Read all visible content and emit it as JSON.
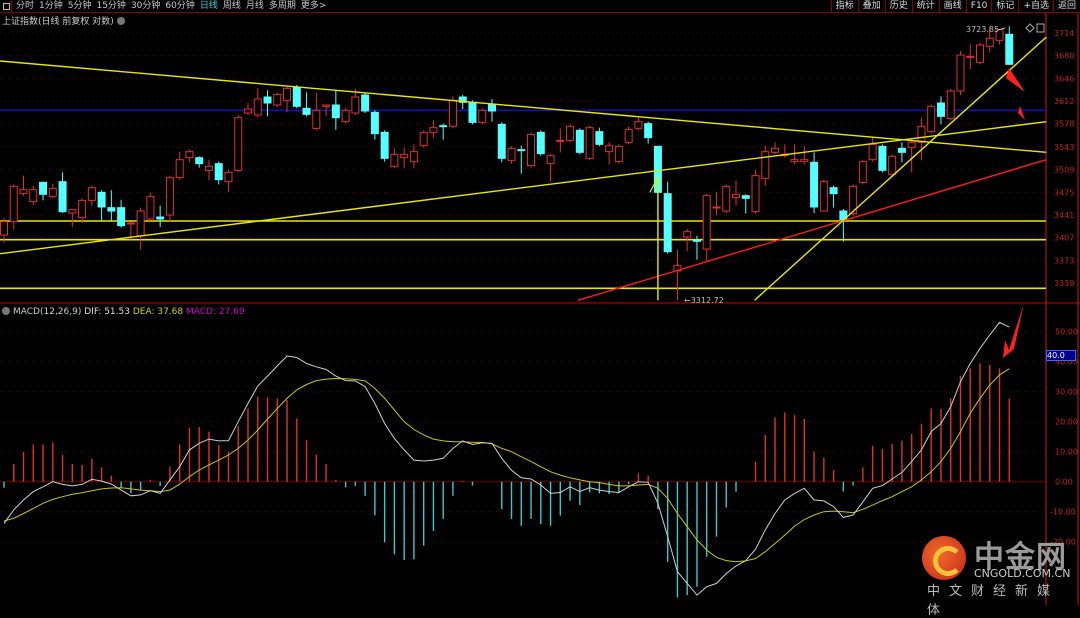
{
  "toolbar": {
    "left": [
      "分时",
      "1分钟",
      "5分钟",
      "15分钟",
      "30分钟",
      "60分钟",
      "日线",
      "周线",
      "月线",
      "多周期",
      "更多>"
    ],
    "active": "日线",
    "right": [
      "指标",
      "叠加",
      "历史",
      "统计",
      "画线",
      "F10",
      "标记",
      "+自选",
      "返回"
    ]
  },
  "subtitle": "上证指数(日线 前复权 对数)",
  "macd_header": {
    "name": "MACD(12,26,9)",
    "dif": "DIF: 51.53",
    "dea": "DEA: 37.68",
    "macd": "MACD: 27.69"
  },
  "macd_highlight": "40.0",
  "logo": {
    "cn": "中金网",
    "domain": "CNGOLD.COM.CN",
    "tagline": "中文财经新媒体"
  },
  "colors": {
    "up": "#e03030",
    "down": "#54ffff",
    "dif": "#d0d0d0",
    "dea": "#c8c800",
    "macd_label": "#d000d0",
    "axis": "#c02020",
    "grid": "#5a0000"
  },
  "chart_data": [
    {
      "type": "candlestick",
      "title": "上证指数",
      "y_scale": "log",
      "ylim": [
        3312,
        3724
      ],
      "yticks": [
        3714,
        3680,
        3646,
        3612,
        3578,
        3543,
        3509,
        3475,
        3441,
        3407,
        3373,
        3339
      ],
      "annotations": {
        "high": "3723.85",
        "low": "3312.72"
      },
      "candles_ohlc_note": "[open, close, high, low]",
      "candles": [
        [
          3411,
          3431,
          3437,
          3399
        ],
        [
          3431,
          3484,
          3487,
          3419
        ],
        [
          3473,
          3479,
          3500,
          3470
        ],
        [
          3461,
          3479,
          3485,
          3456
        ],
        [
          3490,
          3472,
          3491,
          3463
        ],
        [
          3469,
          3481,
          3488,
          3466
        ],
        [
          3491,
          3446,
          3505,
          3444
        ],
        [
          3444,
          3449,
          3450,
          3423
        ],
        [
          3437,
          3463,
          3466,
          3429
        ],
        [
          3463,
          3482,
          3485,
          3455
        ],
        [
          3475,
          3453,
          3478,
          3432
        ],
        [
          3452,
          3447,
          3478,
          3432
        ],
        [
          3452,
          3425,
          3464,
          3422
        ],
        [
          3428,
          3429,
          3431,
          3404
        ],
        [
          3410,
          3447,
          3452,
          3389
        ],
        [
          3435,
          3469,
          3475,
          3432
        ],
        [
          3438,
          3435,
          3455,
          3423
        ],
        [
          3441,
          3497,
          3500,
          3431
        ],
        [
          3497,
          3524,
          3536,
          3494
        ],
        [
          3527,
          3536,
          3539,
          3520
        ],
        [
          3527,
          3518,
          3529,
          3512
        ],
        [
          3508,
          3514,
          3524,
          3493
        ],
        [
          3518,
          3494,
          3521,
          3487
        ],
        [
          3491,
          3505,
          3509,
          3476
        ],
        [
          3508,
          3587,
          3591,
          3505
        ],
        [
          3594,
          3600,
          3609,
          3591
        ],
        [
          3591,
          3615,
          3631,
          3587
        ],
        [
          3618,
          3609,
          3628,
          3589
        ],
        [
          3606,
          3622,
          3625,
          3603
        ],
        [
          3613,
          3631,
          3634,
          3595
        ],
        [
          3633,
          3604,
          3636,
          3601
        ],
        [
          3601,
          3592,
          3625,
          3589
        ],
        [
          3571,
          3598,
          3624,
          3568
        ],
        [
          3604,
          3606,
          3607,
          3589
        ],
        [
          3606,
          3587,
          3627,
          3569
        ],
        [
          3581,
          3598,
          3602,
          3578
        ],
        [
          3594,
          3618,
          3630,
          3591
        ],
        [
          3621,
          3597,
          3624,
          3594
        ],
        [
          3595,
          3563,
          3598,
          3554
        ],
        [
          3565,
          3526,
          3568,
          3521
        ],
        [
          3514,
          3532,
          3541,
          3511
        ],
        [
          3527,
          3532,
          3542,
          3511
        ],
        [
          3521,
          3536,
          3547,
          3511
        ],
        [
          3545,
          3565,
          3568,
          3542
        ],
        [
          3565,
          3572,
          3583,
          3557
        ],
        [
          3575,
          3574,
          3578,
          3554
        ],
        [
          3574,
          3613,
          3619,
          3571
        ],
        [
          3618,
          3610,
          3621,
          3600
        ],
        [
          3610,
          3580,
          3613,
          3577
        ],
        [
          3580,
          3598,
          3601,
          3577
        ],
        [
          3607,
          3597,
          3615,
          3581
        ],
        [
          3577,
          3526,
          3580,
          3520
        ],
        [
          3523,
          3541,
          3544,
          3518
        ],
        [
          3539,
          3538,
          3545,
          3503
        ],
        [
          3515,
          3562,
          3565,
          3512
        ],
        [
          3565,
          3533,
          3568,
          3530
        ],
        [
          3518,
          3530,
          3533,
          3491
        ],
        [
          3552,
          3553,
          3571,
          3535
        ],
        [
          3553,
          3574,
          3577,
          3550
        ],
        [
          3568,
          3535,
          3571,
          3532
        ],
        [
          3526,
          3572,
          3575,
          3523
        ],
        [
          3566,
          3547,
          3572,
          3544
        ],
        [
          3536,
          3545,
          3550,
          3517
        ],
        [
          3521,
          3544,
          3547,
          3518
        ],
        [
          3550,
          3569,
          3574,
          3547
        ],
        [
          3571,
          3581,
          3587,
          3568
        ],
        [
          3578,
          3557,
          3581,
          3548
        ],
        [
          3544,
          3475,
          3545,
          3470
        ],
        [
          3473,
          3386,
          3491,
          3383
        ],
        [
          3357,
          3365,
          3389,
          3313
        ],
        [
          3408,
          3416,
          3420,
          3387
        ],
        [
          3403,
          3402,
          3410,
          3374
        ],
        [
          3390,
          3470,
          3473,
          3371
        ],
        [
          3452,
          3453,
          3476,
          3441
        ],
        [
          3447,
          3484,
          3487,
          3444
        ],
        [
          3467,
          3472,
          3493,
          3455
        ],
        [
          3470,
          3466,
          3472,
          3443
        ],
        [
          3446,
          3500,
          3509,
          3443
        ],
        [
          3496,
          3536,
          3545,
          3485
        ],
        [
          3535,
          3541,
          3550,
          3532
        ],
        [
          3530,
          3532,
          3547,
          3527
        ],
        [
          3521,
          3524,
          3547,
          3517
        ],
        [
          3521,
          3524,
          3544,
          3517
        ],
        [
          3520,
          3453,
          3535,
          3444
        ],
        [
          3447,
          3491,
          3494,
          3446
        ],
        [
          3482,
          3473,
          3485,
          3452
        ],
        [
          3447,
          3434,
          3450,
          3401
        ],
        [
          3443,
          3484,
          3487,
          3440
        ],
        [
          3490,
          3521,
          3524,
          3487
        ],
        [
          3524,
          3547,
          3557,
          3521
        ],
        [
          3544,
          3508,
          3547,
          3505
        ],
        [
          3502,
          3529,
          3532,
          3499
        ],
        [
          3541,
          3535,
          3550,
          3520
        ],
        [
          3542,
          3550,
          3554,
          3505
        ],
        [
          3550,
          3574,
          3587,
          3523
        ],
        [
          3566,
          3604,
          3607,
          3563
        ],
        [
          3609,
          3589,
          3619,
          3577
        ],
        [
          3586,
          3627,
          3630,
          3583
        ],
        [
          3627,
          3681,
          3687,
          3621
        ],
        [
          3678,
          3679,
          3697,
          3660
        ],
        [
          3670,
          3696,
          3699,
          3667
        ],
        [
          3694,
          3706,
          3723.85,
          3685
        ],
        [
          3703,
          3719,
          3720,
          3697
        ],
        [
          3712,
          3667,
          3724,
          3666
        ]
      ],
      "trendlines": [
        {
          "color": "#e8e800",
          "from": [
            -0.4,
            3672
          ],
          "to": [
            106.8,
            3535
          ]
        },
        {
          "color": "#e8e800",
          "from": [
            -0.4,
            3383
          ],
          "to": [
            106.8,
            3581
          ]
        },
        {
          "color": "#ff1a1a",
          "from": [
            58.8,
            3313
          ],
          "to": [
            106.8,
            3524
          ]
        },
        {
          "color": "#e8e800",
          "from": [
            76.9,
            3313
          ],
          "to": [
            106.8,
            3708
          ]
        }
      ],
      "hlines": [
        {
          "price": 3598,
          "color": "#1010c0"
        },
        {
          "price": 3432,
          "color": "#e8e800"
        },
        {
          "price": 3404,
          "color": "#e8e800"
        },
        {
          "price": 3331,
          "color": "#e8e800"
        }
      ],
      "vline": {
        "bar": 67,
        "from": 3500,
        "to": 3313,
        "color": "#e8e800"
      }
    },
    {
      "type": "bar+line",
      "title": "MACD(12,26,9)",
      "ylim": [
        -35,
        55
      ],
      "yticks": [
        50,
        40,
        30,
        20,
        10,
        0,
        -10,
        -20
      ],
      "macd": [
        -2,
        5.9,
        10,
        12.4,
        12.4,
        13.1,
        8.9,
        5.9,
        5.6,
        7.6,
        4.8,
        2,
        -2.2,
        -3.9,
        -2.8,
        0.6,
        -1.4,
        5,
        12.4,
        18,
        18.2,
        16.7,
        12.2,
        10,
        18.6,
        24.4,
        28.3,
        28.1,
        27.8,
        27.2,
        21.1,
        13.9,
        9.1,
        5.9,
        0.6,
        -1.9,
        -1.4,
        -4.7,
        -11.1,
        -20.2,
        -24.2,
        -26.1,
        -25.9,
        -21.3,
        -16.4,
        -12.4,
        -4.7,
        0.3,
        -1.3,
        0,
        0,
        -9.1,
        -12.4,
        -14.7,
        -12.4,
        -14.1,
        -14.7,
        -11.3,
        -6.3,
        -7.8,
        -3.6,
        -3.9,
        -4.1,
        -3.9,
        -0.8,
        2.8,
        2,
        -9.1,
        -26.7,
        -38.6,
        -37.8,
        -35,
        -25,
        -18.3,
        -8.6,
        -3.3,
        0,
        6.7,
        15.6,
        21.4,
        23.1,
        22.2,
        20.9,
        10,
        8,
        3.9,
        -3.3,
        -1.3,
        4.8,
        12,
        10.9,
        12.6,
        13.7,
        15.9,
        19.2,
        24.4,
        24.2,
        27.8,
        35.3,
        37.8,
        39.4,
        38.9,
        37.8,
        27.69
      ],
      "dif": [
        -13.9,
        -9.4,
        -6.1,
        -3.3,
        -1.7,
        0,
        -0.9,
        -1.4,
        -0.9,
        0.8,
        0.2,
        -0.8,
        -2.8,
        -4.7,
        -4.4,
        -3,
        -3.9,
        0.6,
        5,
        10.6,
        12.8,
        14.2,
        13.6,
        13.7,
        20,
        26.1,
        31.9,
        35.2,
        38.6,
        41.9,
        41.4,
        39.4,
        38.3,
        37.4,
        35.2,
        33.7,
        33.6,
        31.7,
        26.1,
        19.4,
        14.4,
        10.6,
        7.2,
        6.9,
        7.2,
        7.8,
        11.1,
        13.6,
        12.4,
        13,
        12.8,
        7.8,
        3.8,
        1.3,
        0.9,
        -1.1,
        -3.9,
        -3.6,
        -1.7,
        -3.3,
        -2,
        -2.8,
        -3.3,
        -3.6,
        -1.7,
        0,
        -0.2,
        -7.2,
        -18.3,
        -30,
        -33.9,
        -37.8,
        -35,
        -33.9,
        -30.6,
        -28.1,
        -26.3,
        -22.5,
        -16.1,
        -10.6,
        -6.1,
        -3.9,
        -2.2,
        -6.1,
        -6.4,
        -8.3,
        -11.9,
        -11.1,
        -6.7,
        -2.2,
        -1.3,
        0.9,
        3.1,
        6.7,
        10.6,
        16.7,
        19.4,
        25,
        33.3,
        39.4,
        44.4,
        48.9,
        53.1,
        51.53
      ],
      "dea": [
        -13.1,
        -12.2,
        -10.6,
        -8.9,
        -7.2,
        -5.9,
        -5,
        -4.2,
        -3.7,
        -3,
        -2.4,
        -2.1,
        -2,
        -2.4,
        -2.8,
        -3,
        -3.3,
        -2.8,
        -0.8,
        1.7,
        3.9,
        5.6,
        7.2,
        8.9,
        11.1,
        13.9,
        17.2,
        20.9,
        24.4,
        27.8,
        30.6,
        32.4,
        33.7,
        34.2,
        34.4,
        34.3,
        34.1,
        33.6,
        31.1,
        27.8,
        23.9,
        20,
        17.4,
        15.6,
        14.2,
        13.6,
        13.3,
        13.3,
        13.1,
        13.1,
        12.6,
        11.1,
        10,
        8.3,
        6.7,
        5,
        3.3,
        2.2,
        1.3,
        0.6,
        0,
        -0.3,
        -0.9,
        -1.4,
        -1.4,
        -1.1,
        -0.9,
        -2.2,
        -5.6,
        -10.6,
        -15,
        -19.4,
        -22.8,
        -25.2,
        -26.3,
        -26.7,
        -26.4,
        -25.6,
        -23.3,
        -20.6,
        -17.8,
        -14.8,
        -12.6,
        -11.1,
        -10,
        -9.8,
        -10,
        -10.3,
        -9.2,
        -7.8,
        -6.3,
        -5,
        -3.3,
        -1.7,
        0.6,
        3.3,
        6.7,
        11.1,
        16.7,
        22.8,
        27.8,
        32.2,
        35.6,
        37.68
      ]
    }
  ]
}
